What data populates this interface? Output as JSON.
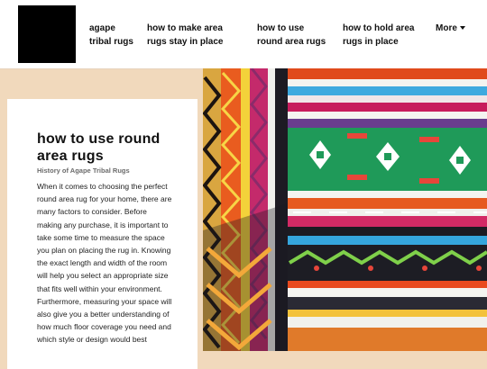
{
  "nav": {
    "items": [
      {
        "label": "agape tribal rugs"
      },
      {
        "label": "how to make area rugs stay in place"
      },
      {
        "label": "how to use round area rugs"
      },
      {
        "label": "how to hold area rugs in place"
      }
    ],
    "more_label": "More"
  },
  "article": {
    "title": "how to use round area rugs",
    "subtitle": "History of Agape Tribal Rugs",
    "body": "When it comes to choosing the perfect round area rug for your home, there are many factors to consider. Before making any purchase, it is important to take some time to measure the space you plan on placing the rug in. Knowing the exact length and width of the room will help you select an appropriate size that fits well within your environment. Furthermore, measuring your space will also give you a better understanding of how much floor coverage you need and which style or design would best"
  },
  "hero_image": {
    "icon": "woven-tribal-rug-photo"
  },
  "colors": {
    "page_background": "#f1d9bc",
    "header_background": "#ffffff",
    "logo": "#000000"
  }
}
